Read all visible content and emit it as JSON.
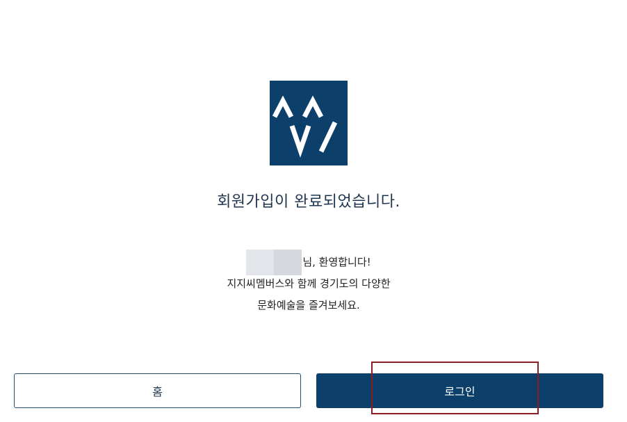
{
  "logo": {
    "icon": "ggc-logo-icon",
    "brand_color": "#0d3f6b"
  },
  "main": {
    "title": "회원가입이 완료되었습니다.",
    "greeting_suffix": "님, 환영합니다!",
    "line2": "지지씨멤버스와 함께 경기도의 다양한",
    "line3": "문화예술을 즐겨보세요."
  },
  "buttons": {
    "home_label": "홈",
    "login_label": "로그인"
  },
  "colors": {
    "primary": "#0d3f6b",
    "highlight": "#8b1c24"
  }
}
